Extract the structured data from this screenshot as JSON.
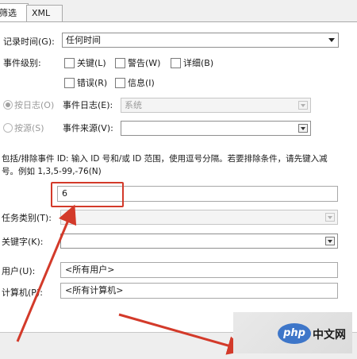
{
  "tabs": [
    {
      "label": "筛选器",
      "active": true
    },
    {
      "label": "XML",
      "active": false
    }
  ],
  "form": {
    "logged_label": "记录时间(G):",
    "logged_value": "任何时间",
    "event_level_label": "事件级别:",
    "levels": [
      {
        "label": "关键(L)",
        "checked": false
      },
      {
        "label": "警告(W)",
        "checked": false
      },
      {
        "label": "详细(B)",
        "checked": false
      },
      {
        "label": "错误(R)",
        "checked": false
      },
      {
        "label": "信息(I)",
        "checked": false
      }
    ],
    "by_log_label": "按日志(O)",
    "event_logs_label": "事件日志(E):",
    "event_logs_value": "系统",
    "by_source_label": "按源(S)",
    "event_sources_label": "事件来源(V):",
    "event_sources_value": "",
    "ids_description_line1": "包括/排除事件 ID: 输入 ID 号和/或 ID 范围，使用逗号分隔。若要排除条件，请先键入减",
    "ids_description_line2": "号。例如 1,3,5-99,-76(N)",
    "event_id_value": "6",
    "task_category_label": "任务类别(T):",
    "keywords_label": "关键字(K):",
    "user_label": "用户(U):",
    "user_value": "<所有用户>",
    "computer_label": "计算机(P):",
    "computer_value": "<所有计算机>"
  },
  "watermark": {
    "logo_text": "php",
    "site_text": "中文网"
  },
  "colors": {
    "highlight": "#d33a2a",
    "arrow": "#d33a2a"
  }
}
